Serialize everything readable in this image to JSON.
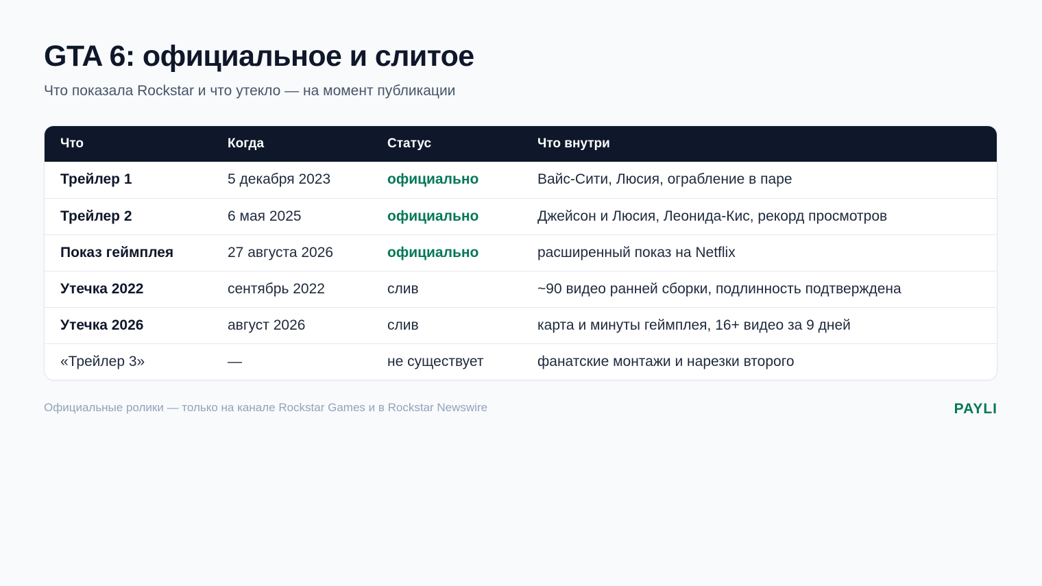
{
  "title": "GTA 6: официальное и слитое",
  "subtitle": "Что показала Rockstar и что утекло — на момент публикации",
  "table": {
    "headers": [
      "Что",
      "Когда",
      "Статус",
      "Что внутри"
    ],
    "rows": [
      {
        "what": "Трейлер 1",
        "when": "5 декабря 2023",
        "status": "официально",
        "inside": "Вайс-Сити, Люсия, ограбление в паре"
      },
      {
        "what": "Трейлер 2",
        "when": "6 мая 2025",
        "status": "официально",
        "inside": "Джейсон и Люсия, Леонида-Кис, рекорд просмотров"
      },
      {
        "what": "Показ геймплея",
        "when": "27 августа 2026",
        "status": "официально",
        "inside": "расширенный показ на Netflix"
      },
      {
        "what": "Утечка 2022",
        "when": "сентябрь 2022",
        "status": "слив",
        "inside": "~90 видео ранней сборки, подлинность подтверждена"
      },
      {
        "what": "Утечка 2026",
        "when": "август 2026",
        "status": "слив",
        "inside": "карта и минуты геймплея, 16+ видео за 9 дней"
      },
      {
        "what": "«Трейлер 3»",
        "when": "—",
        "status": "не существует",
        "inside": "фанатские монтажи и нарезки второго"
      }
    ]
  },
  "footer": {
    "note": "Официальные ролики — только на канале Rockstar Games и в Rockstar Newswire",
    "brand": "PAYLI"
  },
  "colors": {
    "header_bg": "#0f172a",
    "official_status": "#047857",
    "brand": "#047857",
    "page_bg": "#f8fafc"
  }
}
